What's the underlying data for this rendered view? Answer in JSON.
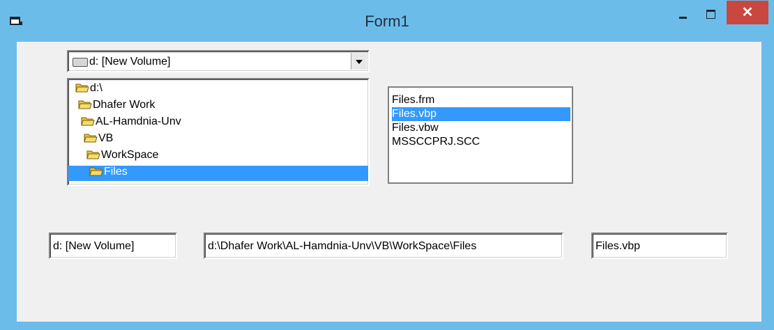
{
  "window": {
    "title": "Form1",
    "close_label": "✕"
  },
  "drive": {
    "value": "d: [New Volume]"
  },
  "dirlist": {
    "items": [
      {
        "label": "d:\\"
      },
      {
        "label": "Dhafer Work"
      },
      {
        "label": "AL-Hamdnia-Unv"
      },
      {
        "label": "VB"
      },
      {
        "label": "WorkSpace"
      },
      {
        "label": "Files"
      }
    ]
  },
  "filelist": {
    "items": [
      {
        "label": "Files.frm"
      },
      {
        "label": "Files.vbp"
      },
      {
        "label": "Files.vbw"
      },
      {
        "label": "MSSCCPRJ.SCC"
      }
    ]
  },
  "textboxes": {
    "drive_text": "d: [New Volume]",
    "path_text": "d:\\Dhafer Work\\AL-Hamdnia-Unv\\VB\\WorkSpace\\Files",
    "file_text": "Files.vbp"
  },
  "colors": {
    "selection": "#3399ff",
    "frame": "#6cbcea",
    "close": "#c9473e"
  }
}
